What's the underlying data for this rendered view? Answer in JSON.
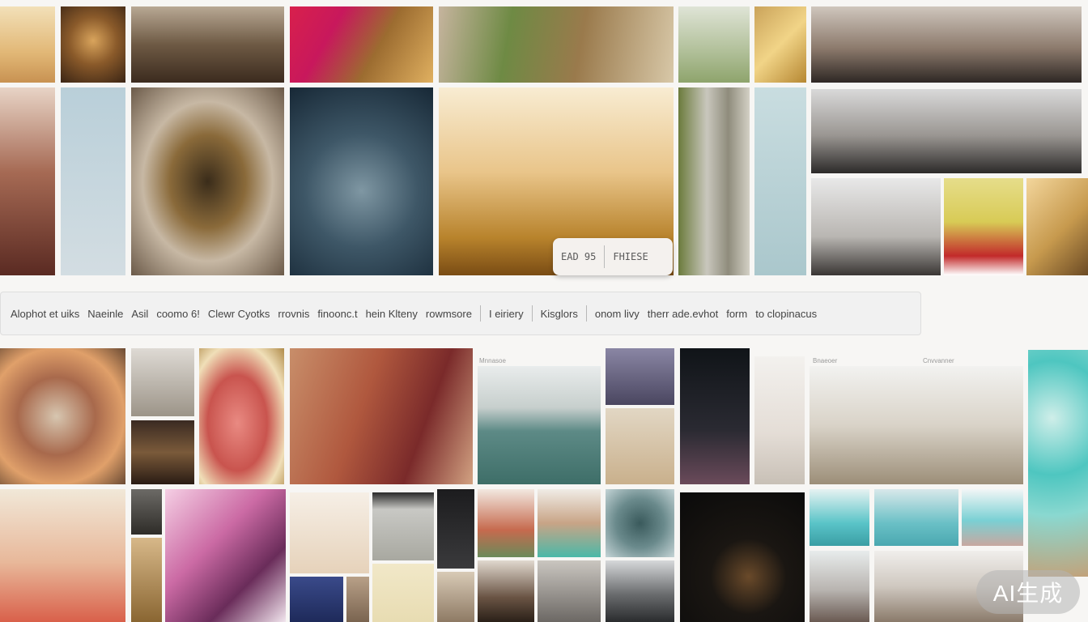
{
  "gallery": {
    "overlay_pill": {
      "left_text": "EAD 95",
      "right_text": "FHIESE"
    },
    "filter_bar": {
      "groups": [
        [
          "Alophot et uiks",
          "Naeinle",
          "Asil",
          "coomo 6!",
          "Clewr Cyotks",
          "rrovnis",
          "finoonc.t",
          "hein Klteny",
          "rowmsore"
        ],
        [
          "I eiriery"
        ],
        [
          "Kisglors"
        ],
        [
          "onom livy",
          "therr ade.evhot",
          "form",
          "to clopinacus"
        ]
      ]
    },
    "tile_captions": {
      "a": "Mnnasoe",
      "b": "Bnaeoer",
      "c": "Cnvvanner"
    },
    "watermark": "AI生成"
  }
}
